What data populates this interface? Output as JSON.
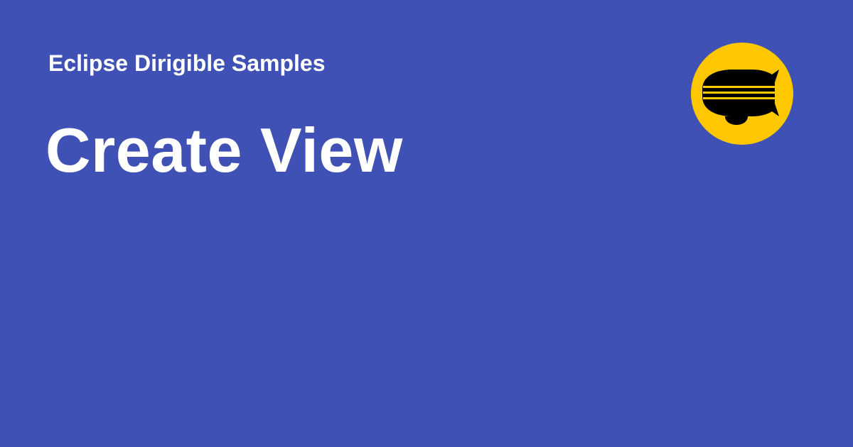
{
  "header": {
    "site_name": "Eclipse Dirigible Samples"
  },
  "main": {
    "title": "Create View"
  },
  "logo": {
    "icon": "dirigible-airship-icon"
  },
  "colors": {
    "background": "#3f51b5",
    "text": "#ffffff",
    "logo_circle": "#ffc700",
    "logo_ship": "#000000"
  }
}
